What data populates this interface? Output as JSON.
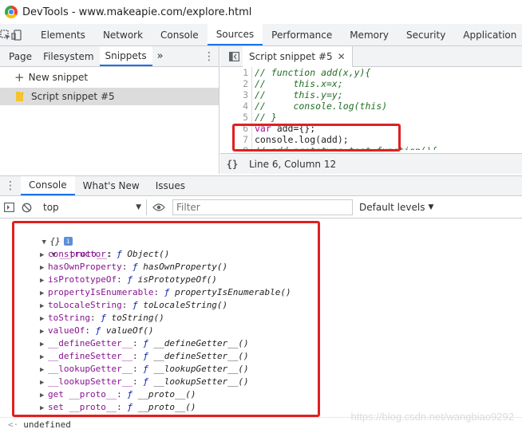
{
  "window": {
    "title": "DevTools - www.makeapie.com/explore.html"
  },
  "toolbar": {
    "tabs": [
      "Elements",
      "Network",
      "Console",
      "Sources",
      "Performance",
      "Memory",
      "Security",
      "Application"
    ],
    "active_tab": "Sources"
  },
  "navigator": {
    "tabs": [
      "Page",
      "Filesystem",
      "Snippets"
    ],
    "active_tab": "Snippets",
    "more_label": "»",
    "new_snippet_label": "New snippet",
    "snippets": [
      "Script snippet #5"
    ]
  },
  "editor": {
    "tab_label": "Script snippet #5",
    "lines": [
      {
        "num": "1",
        "text": "// function add(x,y){",
        "kind": "comment"
      },
      {
        "num": "2",
        "text": "//     this.x=x;",
        "kind": "comment"
      },
      {
        "num": "3",
        "text": "//     this.y=y;",
        "kind": "comment"
      },
      {
        "num": "4",
        "text": "//     console.log(this)",
        "kind": "comment"
      },
      {
        "num": "5",
        "text": "// }",
        "kind": "comment"
      },
      {
        "num": "6",
        "text": "var add={};",
        "kind": "code"
      },
      {
        "num": "7",
        "text": "console.log(add);",
        "kind": "code"
      },
      {
        "num": "8",
        "text": "// add.prototype.test=function(){",
        "kind": "comment"
      }
    ],
    "status": {
      "braces": "{}",
      "position": "Line 6, Column 12"
    }
  },
  "drawer": {
    "tabs": [
      "Console",
      "What's New",
      "Issues"
    ],
    "active_tab": "Console"
  },
  "console_toolbar": {
    "context": "top",
    "filter_placeholder": "Filter",
    "levels_label": "Default levels"
  },
  "console_output": {
    "object_label": "{}",
    "info_badge": "i",
    "proto_label": "__proto__",
    "entries": [
      {
        "key": "constructor",
        "value": "Object()"
      },
      {
        "key": "hasOwnProperty",
        "value": "hasOwnProperty()"
      },
      {
        "key": "isPrototypeOf",
        "value": "isPrototypeOf()"
      },
      {
        "key": "propertyIsEnumerable",
        "value": "propertyIsEnumerable()"
      },
      {
        "key": "toLocaleString",
        "value": "toLocaleString()"
      },
      {
        "key": "toString",
        "value": "toString()"
      },
      {
        "key": "valueOf",
        "value": "valueOf()"
      },
      {
        "key": "__defineGetter__",
        "value": "__defineGetter__()"
      },
      {
        "key": "__defineSetter__",
        "value": "__defineSetter__()"
      },
      {
        "key": "__lookupGetter__",
        "value": "__lookupGetter__()"
      },
      {
        "key": "__lookupSetter__",
        "value": "__lookupSetter__()"
      },
      {
        "key": "get __proto__",
        "value": "__proto__()"
      },
      {
        "key": "set __proto__",
        "value": "__proto__()"
      }
    ],
    "return_value": "undefined"
  },
  "watermark": "https://blog.csdn.net/wangbiao9292",
  "highlight_color": "#e02020"
}
